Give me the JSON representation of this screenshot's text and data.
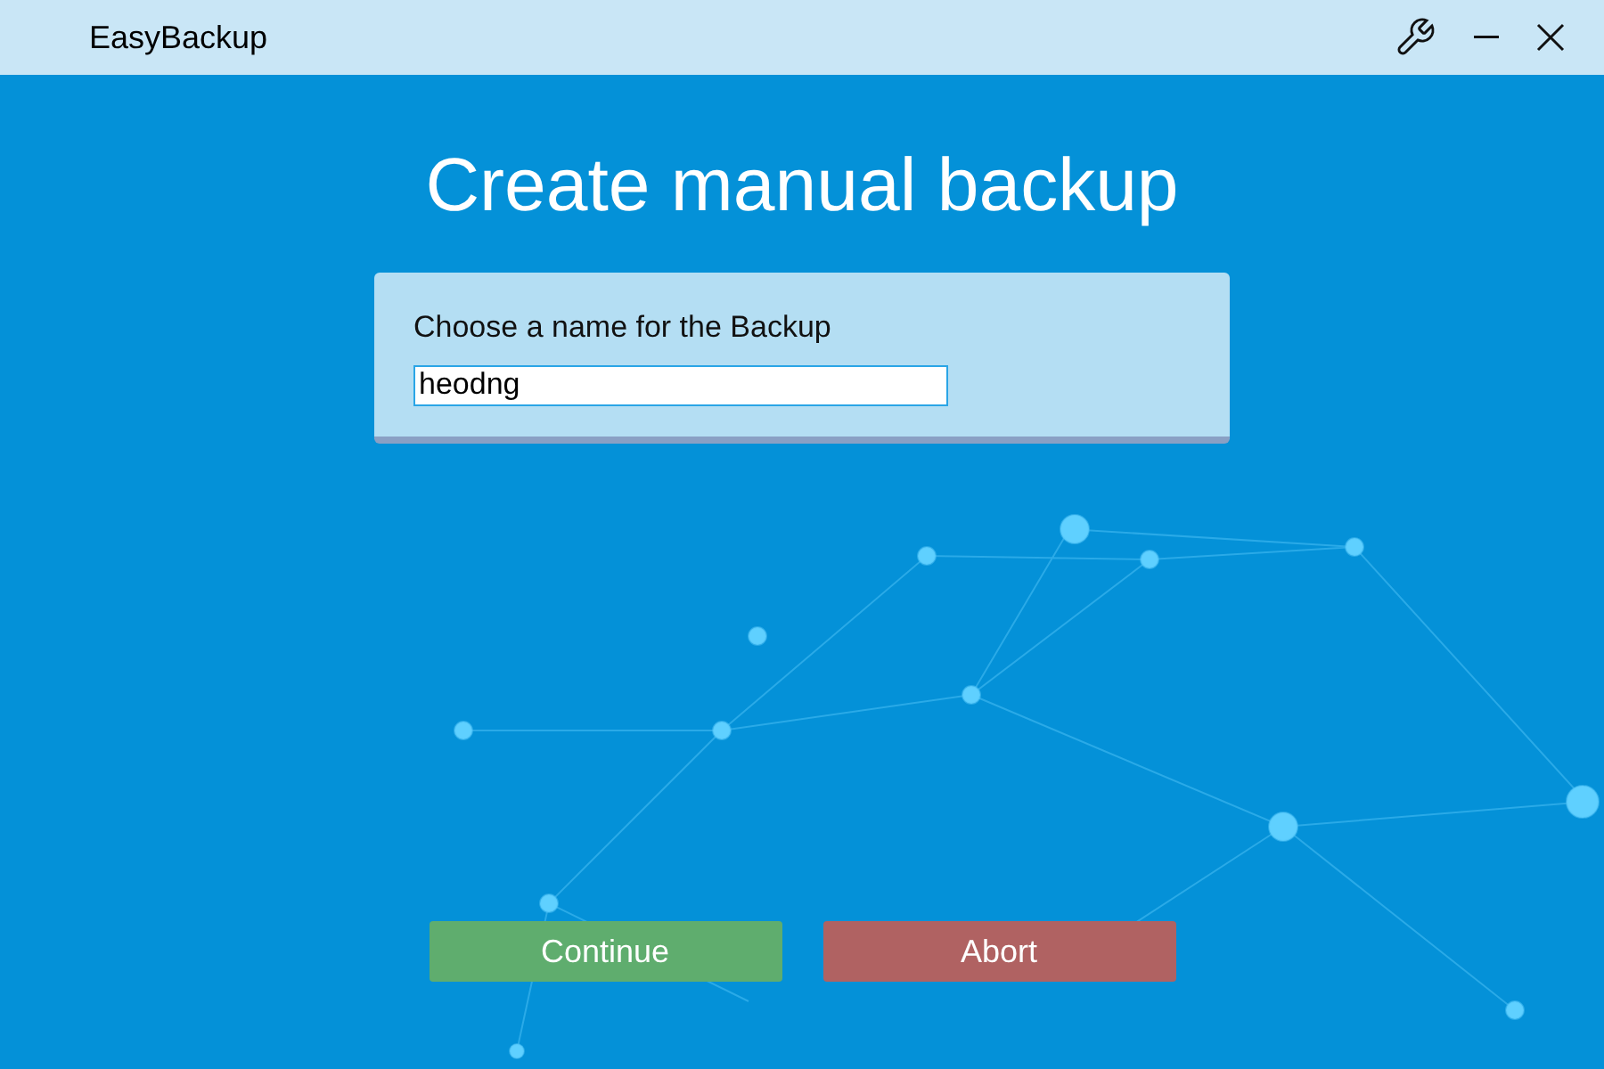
{
  "window": {
    "title": "EasyBackup"
  },
  "heading": "Create manual backup",
  "form": {
    "label": "Choose a name for the Backup",
    "name_field": {
      "value": "heodng"
    }
  },
  "buttons": [
    {
      "label": "Continue",
      "kind": "confirm"
    },
    {
      "label": "Abort",
      "kind": "cancel"
    }
  ]
}
